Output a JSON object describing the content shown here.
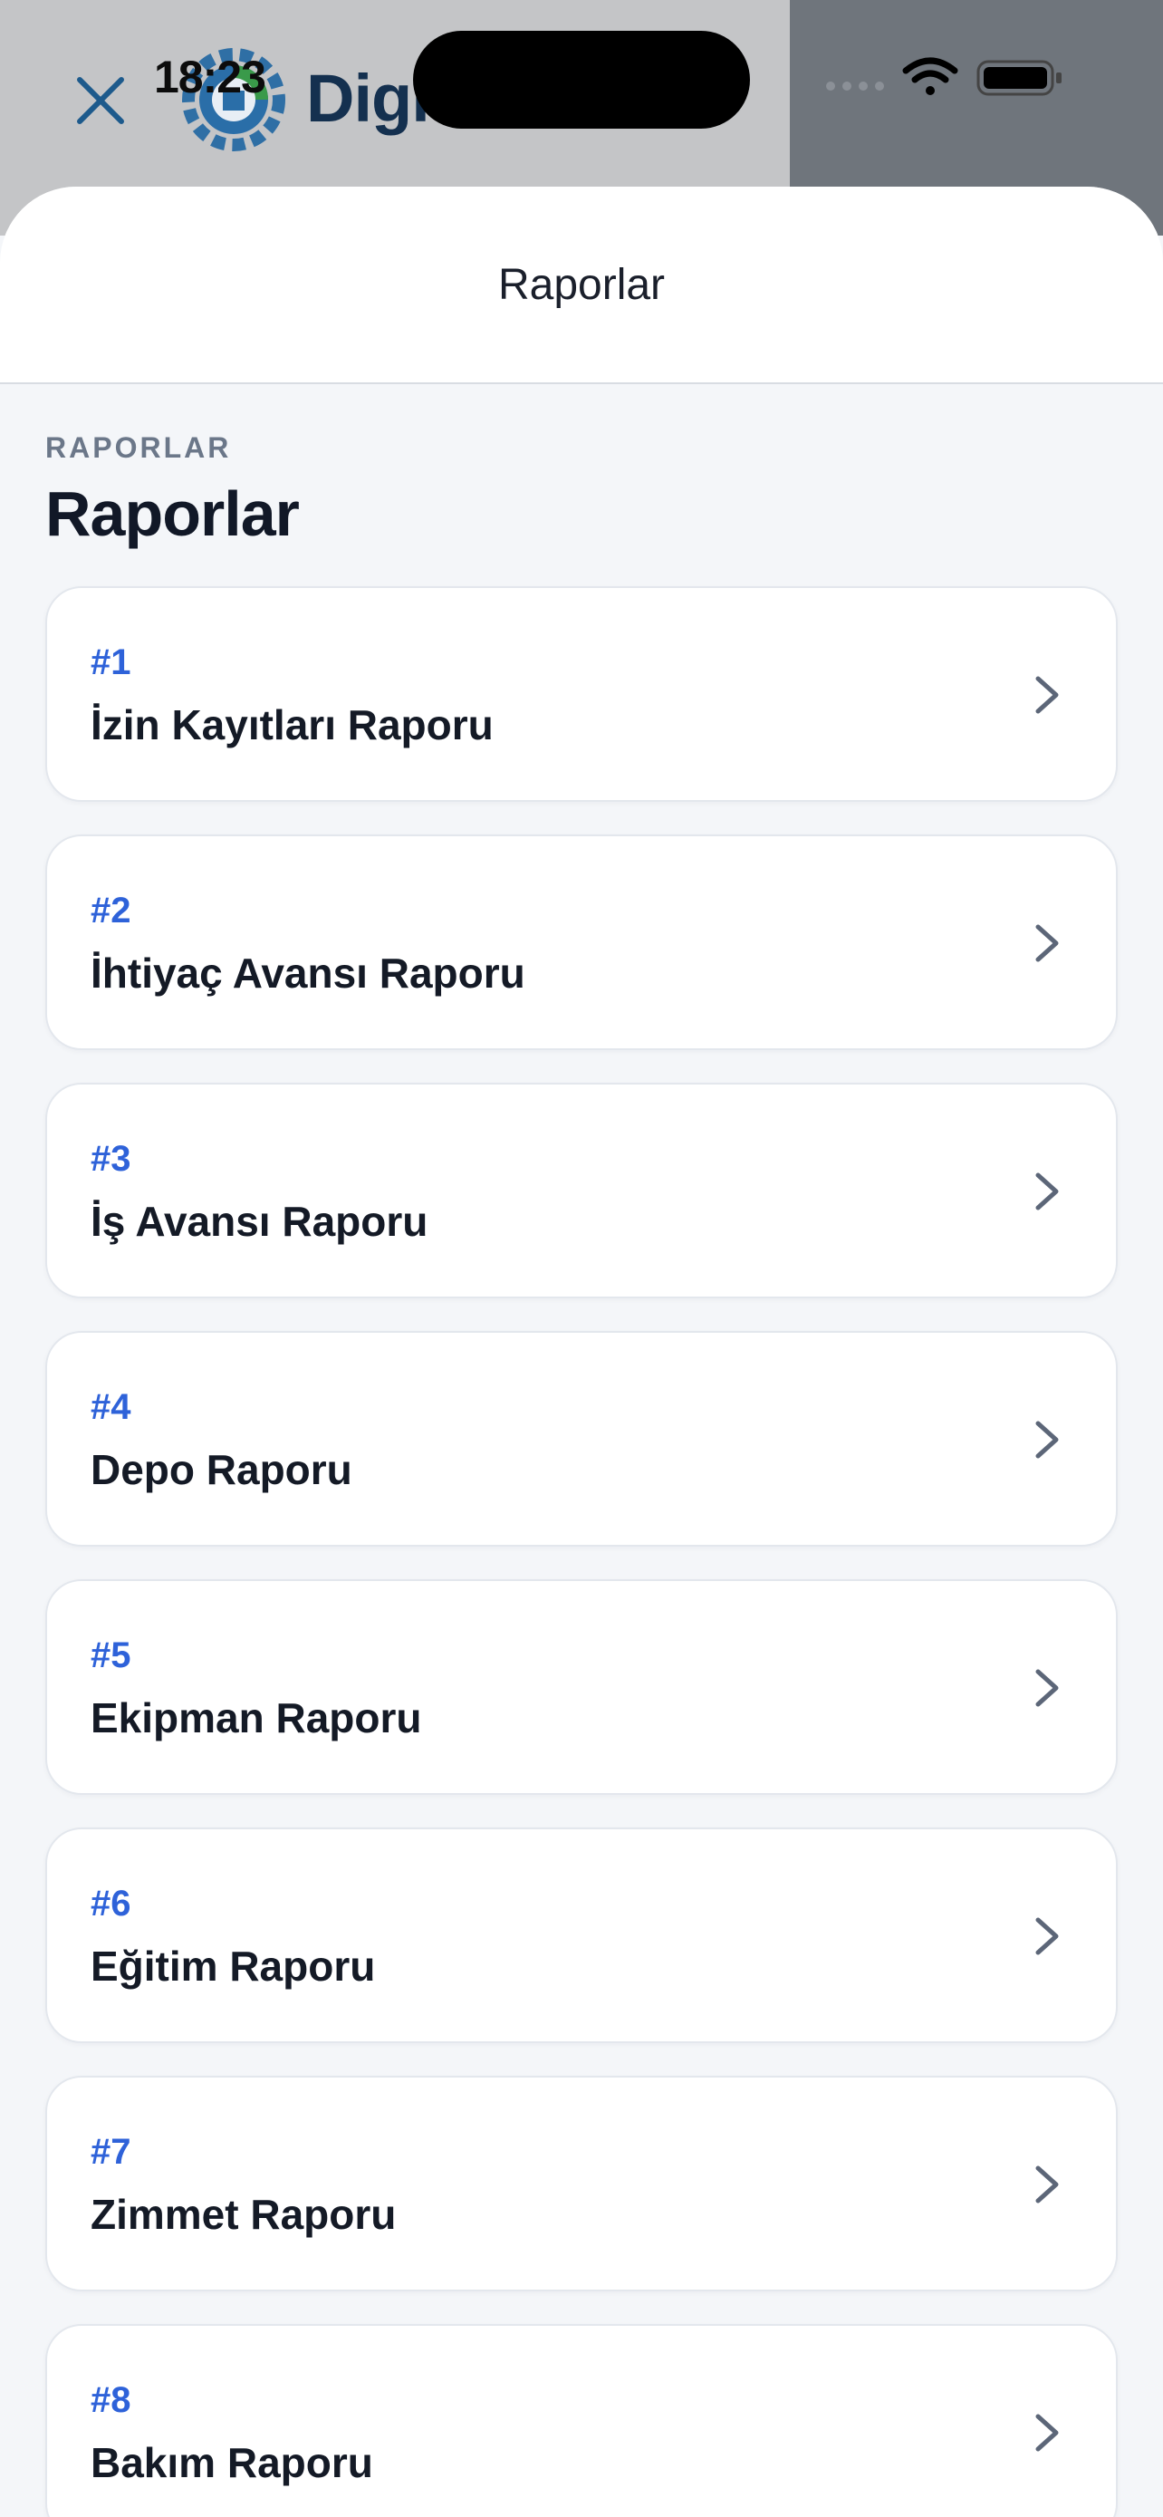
{
  "status_bar": {
    "time": "18:23"
  },
  "background_app": {
    "brand_text": "Digi"
  },
  "sheet": {
    "title": "Raporlar",
    "eyebrow": "RAPORLAR",
    "heading": "Raporlar"
  },
  "reports": [
    {
      "number": "#1",
      "name": "İzin Kayıtları Raporu"
    },
    {
      "number": "#2",
      "name": "İhtiyaç Avansı Raporu"
    },
    {
      "number": "#3",
      "name": "İş Avansı Raporu"
    },
    {
      "number": "#4",
      "name": "Depo Raporu"
    },
    {
      "number": "#5",
      "name": "Ekipman Raporu"
    },
    {
      "number": "#6",
      "name": "Eğitim Raporu"
    },
    {
      "number": "#7",
      "name": "Zimmet Raporu"
    },
    {
      "number": "#8",
      "name": "Bakım Raporu"
    }
  ],
  "colors": {
    "accent": "#2e62d9",
    "text_primary": "#141a26",
    "text_muted": "#6b7789",
    "sheet_background": "#f4f6f9",
    "card_background": "#ffffff"
  },
  "icons": {
    "close": "close-icon",
    "logo": "gear-logo-icon",
    "wifi": "wifi-icon",
    "battery": "battery-icon",
    "row_chevron": "chevron-right-icon"
  }
}
